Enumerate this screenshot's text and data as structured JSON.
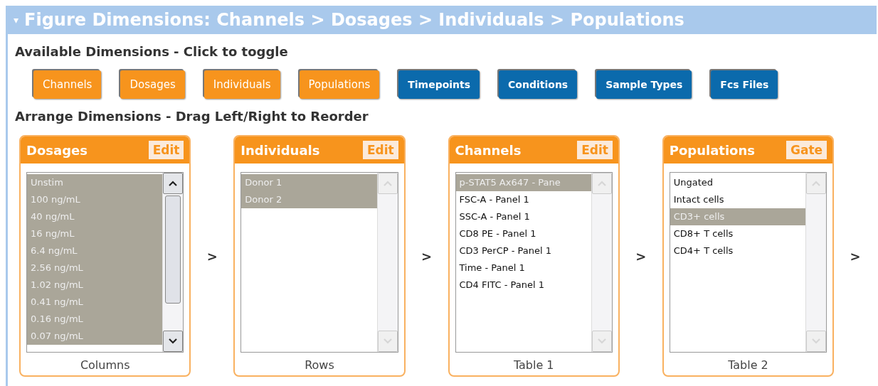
{
  "header": {
    "caret": "▾",
    "title": "Figure Dimensions: Channels > Dosages > Individuals > Populations"
  },
  "available": {
    "title": "Available Dimensions - Click to toggle",
    "buttons": [
      {
        "label": "Channels",
        "selected": true
      },
      {
        "label": "Dosages",
        "selected": true
      },
      {
        "label": "Individuals",
        "selected": true
      },
      {
        "label": "Populations",
        "selected": true
      },
      {
        "label": "Timepoints",
        "selected": false
      },
      {
        "label": "Conditions",
        "selected": false
      },
      {
        "label": "Sample Types",
        "selected": false
      },
      {
        "label": "Fcs Files",
        "selected": false
      }
    ]
  },
  "arrange": {
    "title": "Arrange Dimensions - Drag Left/Right to Reorder",
    "panels": [
      {
        "title": "Dosages",
        "action": "Edit",
        "footer": "Columns",
        "separator": ">",
        "scrollbar_disabled": false,
        "items": [
          {
            "label": "Unstim",
            "selected": true
          },
          {
            "label": "100 ng/mL",
            "selected": true
          },
          {
            "label": "40 ng/mL",
            "selected": true
          },
          {
            "label": "16 ng/mL",
            "selected": true
          },
          {
            "label": "6.4 ng/mL",
            "selected": true
          },
          {
            "label": "2.56 ng/mL",
            "selected": true
          },
          {
            "label": "1.02 ng/mL",
            "selected": true
          },
          {
            "label": "0.41 ng/mL",
            "selected": true
          },
          {
            "label": "0.16 ng/mL",
            "selected": true
          },
          {
            "label": "0.07 ng/mL",
            "selected": true
          }
        ]
      },
      {
        "title": "Individuals",
        "action": "Edit",
        "footer": "Rows",
        "separator": ">",
        "scrollbar_disabled": true,
        "items": [
          {
            "label": "Donor 1",
            "selected": true
          },
          {
            "label": "Donor 2",
            "selected": true
          }
        ]
      },
      {
        "title": "Channels",
        "action": "Edit",
        "footer": "Table 1",
        "separator": ">",
        "scrollbar_disabled": true,
        "items": [
          {
            "label": "p-STAT5 Ax647 - Pane",
            "selected": true
          },
          {
            "label": "FSC-A - Panel 1",
            "selected": false
          },
          {
            "label": "SSC-A - Panel 1",
            "selected": false
          },
          {
            "label": "CD8 PE - Panel 1",
            "selected": false
          },
          {
            "label": "CD3 PerCP - Panel 1",
            "selected": false
          },
          {
            "label": "Time - Panel 1",
            "selected": false
          },
          {
            "label": "CD4 FITC - Panel 1",
            "selected": false
          }
        ]
      },
      {
        "title": "Populations",
        "action": "Gate",
        "footer": "Table 2",
        "separator": ">",
        "scrollbar_disabled": true,
        "items": [
          {
            "label": "Ungated",
            "selected": false
          },
          {
            "label": "Intact cells",
            "selected": false
          },
          {
            "label": "CD3+ cells",
            "selected": true
          },
          {
            "label": "CD8+ T cells",
            "selected": false
          },
          {
            "label": "CD4+ T cells",
            "selected": false
          }
        ]
      }
    ]
  }
}
